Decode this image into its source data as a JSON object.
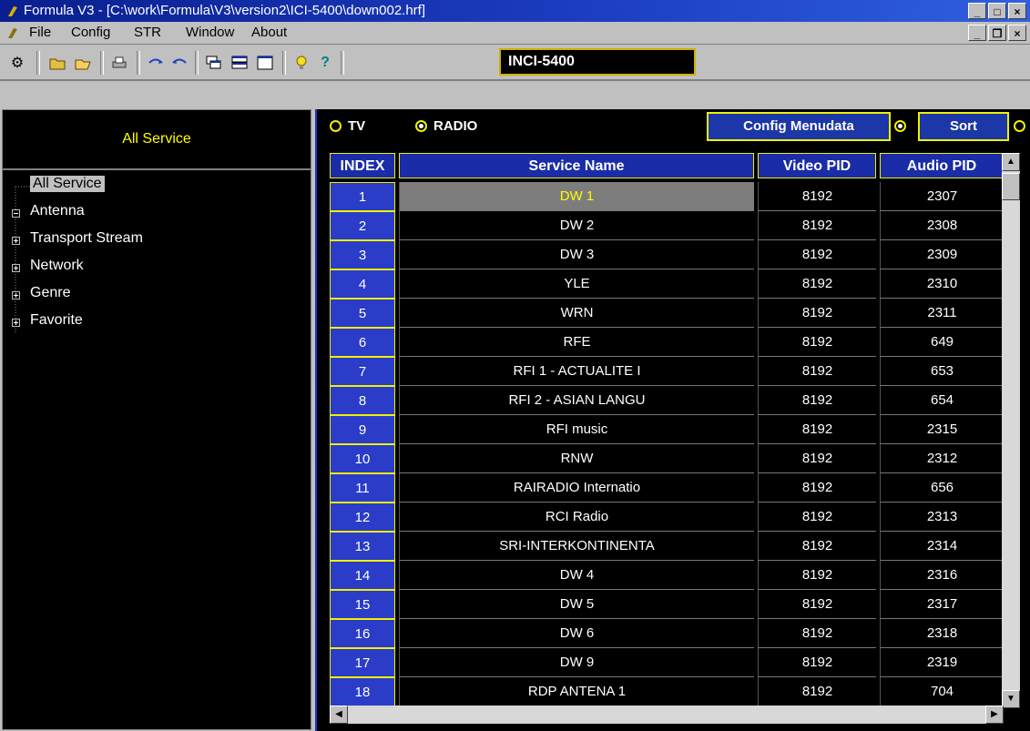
{
  "window": {
    "title": "Formula V3 - [C:\\work\\Formula\\V3\\version2\\ICI-5400\\down002.hrf]"
  },
  "menu": {
    "items": [
      "File",
      "Config",
      "STR",
      "Window",
      "About"
    ]
  },
  "toolbar": {
    "model": "INCI-5400"
  },
  "left": {
    "header": "All Service",
    "tree": [
      {
        "label": "All Service",
        "selected": true
      },
      {
        "label": "Antenna"
      },
      {
        "label": "Transport Stream"
      },
      {
        "label": "Network"
      },
      {
        "label": "Genre"
      },
      {
        "label": "Favorite"
      }
    ]
  },
  "options": {
    "tv_label": "TV",
    "radio_label": "RADIO",
    "selected": "RADIO",
    "config_label": "Config Menudata",
    "sort_label": "Sort"
  },
  "table": {
    "headers": [
      "INDEX",
      "Service Name",
      "Video PID",
      "Audio PID"
    ],
    "rows": [
      [
        "1",
        "DW 1",
        "8192",
        "2307"
      ],
      [
        "2",
        "DW 2",
        "8192",
        "2308"
      ],
      [
        "3",
        "DW 3",
        "8192",
        "2309"
      ],
      [
        "4",
        "YLE",
        "8192",
        "2310"
      ],
      [
        "5",
        "WRN",
        "8192",
        "2311"
      ],
      [
        "6",
        "RFE",
        "8192",
        "649"
      ],
      [
        "7",
        "RFI 1 - ACTUALITE I",
        "8192",
        "653"
      ],
      [
        "8",
        "RFI 2 - ASIAN LANGU",
        "8192",
        "654"
      ],
      [
        "9",
        "RFI music",
        "8192",
        "2315"
      ],
      [
        "10",
        "RNW",
        "8192",
        "2312"
      ],
      [
        "11",
        "RAIRADIO Internatio",
        "8192",
        "656"
      ],
      [
        "12",
        "RCI Radio",
        "8192",
        "2313"
      ],
      [
        "13",
        "SRI-INTERKONTINENTA",
        "8192",
        "2314"
      ],
      [
        "14",
        "DW 4",
        "8192",
        "2316"
      ],
      [
        "15",
        "DW 5",
        "8192",
        "2317"
      ],
      [
        "16",
        "DW 6",
        "8192",
        "2318"
      ],
      [
        "17",
        "DW 9",
        "8192",
        "2319"
      ],
      [
        "18",
        "RDP ANTENA 1",
        "8192",
        "704"
      ]
    ],
    "selected_row": 0
  },
  "colors": {
    "title_bar": "#1d3fc4",
    "index_cell": "#2a3cc8",
    "highlight": "#ffff00",
    "selected_row": "#7d7d7d"
  }
}
